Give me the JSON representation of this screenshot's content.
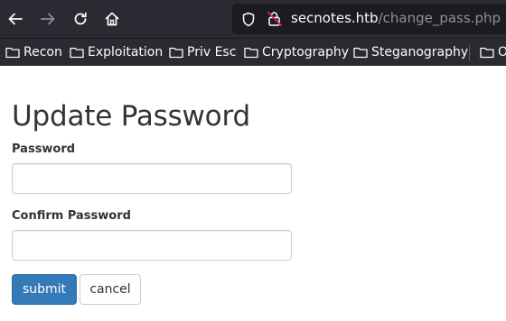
{
  "browser": {
    "nav": {
      "back_icon": "arrow-left-icon",
      "forward_icon": "arrow-right-icon",
      "reload_icon": "reload-icon",
      "home_icon": "home-icon"
    },
    "url": {
      "domain": "secnotes.htb",
      "path": "/change_pass.php",
      "shield_icon": "shield-icon",
      "insecure_icon": "insecure-lock-icon"
    },
    "bookmarks": [
      {
        "label": "Recon"
      },
      {
        "label": "Exploitation"
      },
      {
        "label": "Priv Esc"
      },
      {
        "label": "Cryptography"
      },
      {
        "label": "Steganography"
      },
      {
        "label": "O"
      }
    ]
  },
  "page": {
    "title": "Update Password",
    "password_label": "Password",
    "password_value": "",
    "confirm_label": "Confirm Password",
    "confirm_value": "",
    "submit_label": "submit",
    "cancel_label": "cancel"
  },
  "colors": {
    "chrome_bg": "#2b2a33",
    "urlbar_bg": "#1c1b22",
    "primary_button": "#337ab7"
  }
}
